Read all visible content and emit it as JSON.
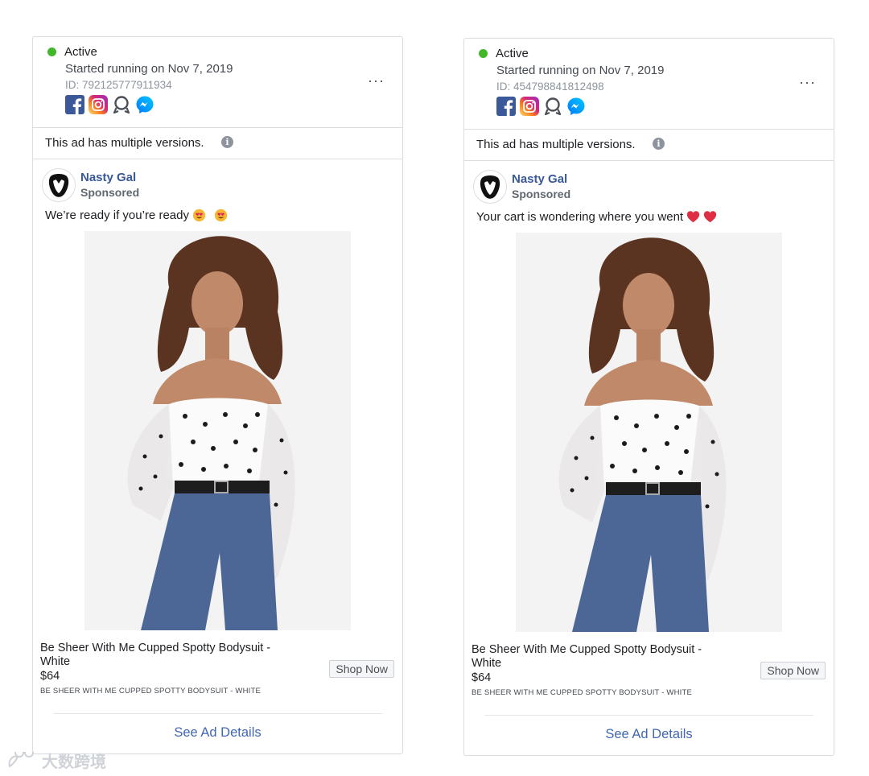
{
  "ads": [
    {
      "status": "Active",
      "started": "Started running on Nov 7, 2019",
      "id": "ID: 792125777911934",
      "more_label": "···",
      "versions_note": "This ad has multiple versions.",
      "page_name": "Nasty Gal",
      "sponsored": "Sponsored",
      "primary_text": "We’re ready if you’re ready",
      "emoji": [
        "heart-eyes-emoji",
        "heart-eyes-emoji"
      ],
      "product_title": "Be Sheer With Me Cupped Spotty Bodysuit - White",
      "price": "$64",
      "caption": "BE SHEER WITH ME CUPPED SPOTTY BODYSUIT - WHITE",
      "cta": "Shop Now",
      "see_details": "See Ad Details"
    },
    {
      "status": "Active",
      "started": "Started running on Nov 7, 2019",
      "id": "ID: 454798841812498",
      "more_label": "···",
      "versions_note": "This ad has multiple versions.",
      "page_name": "Nasty Gal",
      "sponsored": "Sponsored",
      "primary_text": "Your cart is wondering where you went",
      "emoji": [
        "red-heart-emoji",
        "red-heart-emoji"
      ],
      "product_title": "Be Sheer With Me Cupped Spotty Bodysuit - White",
      "price": "$64",
      "caption": "BE SHEER WITH ME CUPPED SPOTTY BODYSUIT - WHITE",
      "cta": "Shop Now",
      "see_details": "See Ad Details"
    }
  ],
  "platform_icons": [
    "facebook-icon",
    "instagram-icon",
    "audience-network-icon",
    "messenger-icon"
  ],
  "watermark": "大数跨境",
  "colors": {
    "active": "#42b72a",
    "link": "#4267b2",
    "page_name": "#385898"
  }
}
